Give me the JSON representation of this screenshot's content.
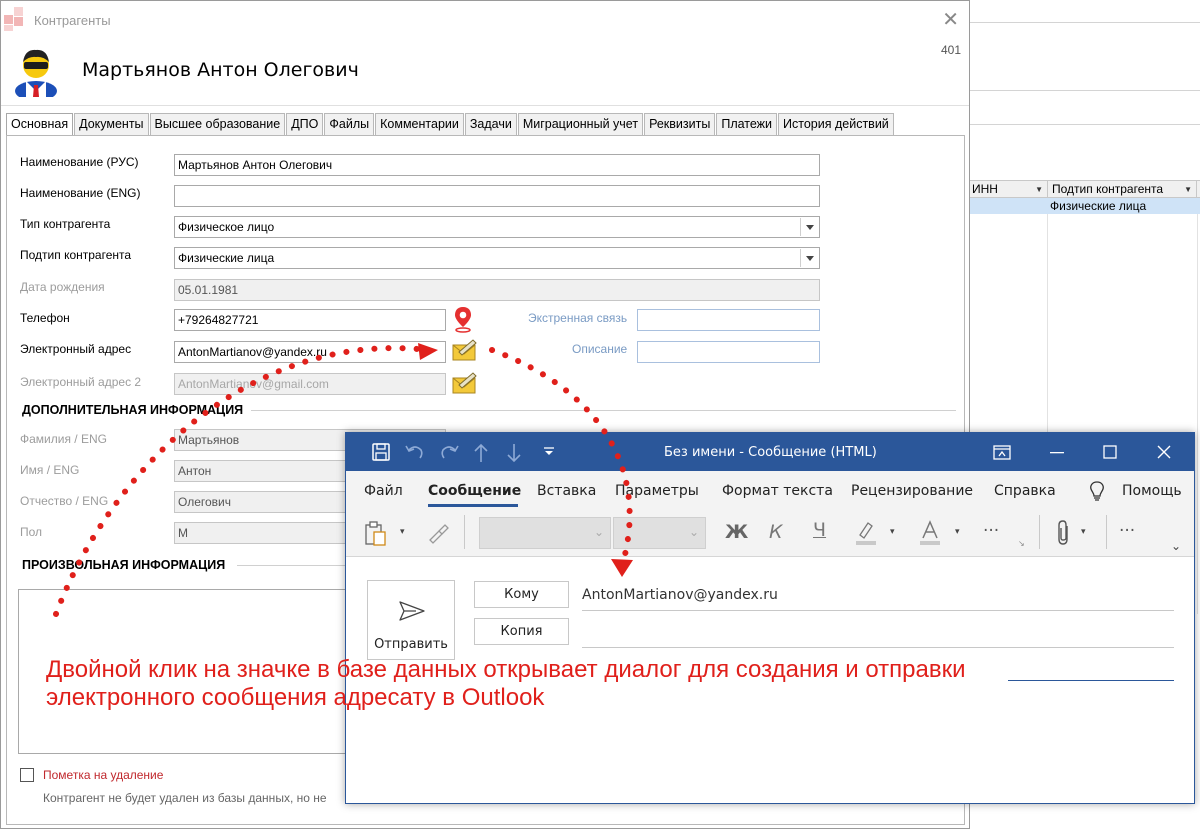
{
  "window": {
    "title": "Контрагенты",
    "record_id": "401",
    "person_name": "Мартьянов Антон Олегович"
  },
  "tabs": [
    {
      "label": "Основная"
    },
    {
      "label": "Документы"
    },
    {
      "label": "Высшее образование"
    },
    {
      "label": "ДПО"
    },
    {
      "label": "Файлы"
    },
    {
      "label": "Комментарии"
    },
    {
      "label": "Задачи"
    },
    {
      "label": "Миграционный учет"
    },
    {
      "label": "Реквизиты"
    },
    {
      "label": "Платежи"
    },
    {
      "label": "История действий"
    }
  ],
  "form": {
    "name_ru_label": "Наименование (РУС)",
    "name_ru_value": "Мартьянов Антон Олегович",
    "name_en_label": "Наименование (ENG)",
    "name_en_value": "",
    "type_label": "Тип контрагента",
    "type_value": "Физическое лицо",
    "subtype_label": "Подтип контрагента",
    "subtype_value": "Физические лица",
    "birth_label": "Дата рождения",
    "birth_value": "05.01.1981",
    "phone_label": "Телефон",
    "phone_value": "+79264827721",
    "email_label": "Электронный адрес",
    "email_value": "AntonMartianov@yandex.ru",
    "email2_label": "Электронный адрес 2",
    "email2_value": "AntonMartianov@gmail.com",
    "emergency_label": "Экстренная связь",
    "emergency_value": "",
    "description_label": "Описание",
    "description_value": ""
  },
  "additional": {
    "header": "ДОПОЛНИТЕЛЬНАЯ ИНФОРМАЦИЯ",
    "surname_label": "Фамилия / ENG",
    "surname_value": "Мартьянов",
    "firstname_label": "Имя / ENG",
    "firstname_value": "Антон",
    "patronymic_label": "Отчество / ENG",
    "patronymic_value": "Олегович",
    "gender_label": "Пол",
    "gender_value": "М"
  },
  "free_info": {
    "header": "ПРОИЗВОЛЬНАЯ ИНФОРМАЦИЯ"
  },
  "deletion": {
    "label": "Пометка на удаление",
    "note": "Контрагент не будет удален из базы данных, но не"
  },
  "background_grid": {
    "col1": "ИНН",
    "col2": "Подтип контрагента",
    "row_value": "Физические лица"
  },
  "outlook": {
    "title": "Без имени  -  Сообщение (HTML)",
    "menu": [
      "Файл",
      "Сообщение",
      "Вставка",
      "Параметры",
      "Формат текста",
      "Рецензирование",
      "Справка",
      "Помощь"
    ],
    "bold_label": "Ж",
    "italic_label": "К",
    "underline_label": "Ч",
    "more_label": "···",
    "send_label": "Отправить",
    "to_label": "Кому",
    "cc_label": "Копия",
    "to_value": "AntonMartianov@yandex.ru"
  },
  "caption": "Двойной клик на значке в базе данных открывает диалог для создания и отправки электронного сообщения адресату в Outlook",
  "colors": {
    "accent": "#2b579a",
    "annotation": "#e0201b",
    "highlight_row": "#cfe3f7"
  }
}
